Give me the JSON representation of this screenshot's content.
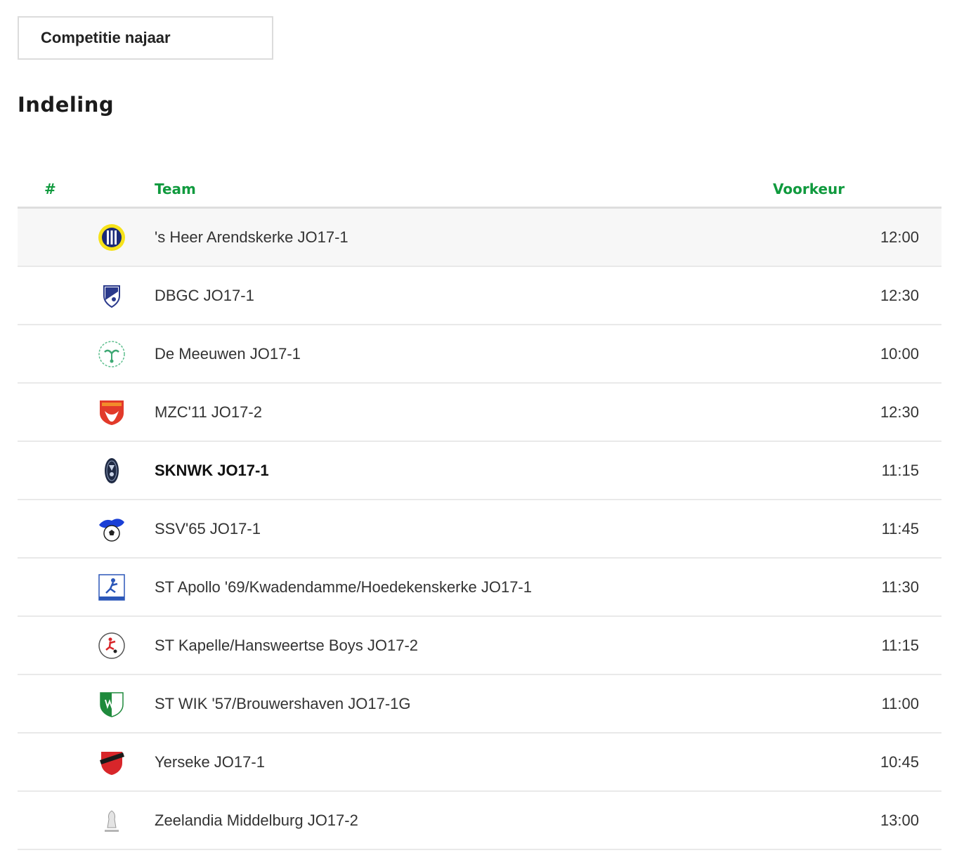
{
  "competition_select": {
    "value": "Competitie najaar"
  },
  "page_title": "Indeling",
  "table": {
    "headers": {
      "rank": "#",
      "team": "Team",
      "preference": "Voorkeur"
    },
    "rows": [
      {
        "team": "'s Heer Arendskerke JO17-1",
        "preference": "12:00",
        "logo_icon": "s-heer-arendskerke-logo-icon"
      },
      {
        "team": "DBGC JO17-1",
        "preference": "12:30",
        "logo_icon": "dbgc-logo-icon"
      },
      {
        "team": "De Meeuwen JO17-1",
        "preference": "10:00",
        "logo_icon": "de-meeuwen-logo-icon"
      },
      {
        "team": "MZC'11 JO17-2",
        "preference": "12:30",
        "logo_icon": "mzc11-logo-icon"
      },
      {
        "team": "SKNWK JO17-1",
        "preference": "11:15",
        "logo_icon": "sknwk-logo-icon",
        "own_team": true
      },
      {
        "team": "SSV'65 JO17-1",
        "preference": "11:45",
        "logo_icon": "ssv65-logo-icon"
      },
      {
        "team": "ST Apollo '69/Kwadendamme/Hoedekenskerke JO17-1",
        "preference": "11:30",
        "logo_icon": "apollo69-logo-icon"
      },
      {
        "team": "ST Kapelle/Hansweertse Boys JO17-2",
        "preference": "11:15",
        "logo_icon": "kapelle-logo-icon"
      },
      {
        "team": "ST WIK '57/Brouwershaven JO17-1G",
        "preference": "11:00",
        "logo_icon": "wik57-logo-icon"
      },
      {
        "team": "Yerseke JO17-1",
        "preference": "10:45",
        "logo_icon": "yerseke-logo-icon"
      },
      {
        "team": "Zeelandia Middelburg JO17-2",
        "preference": "13:00",
        "logo_icon": "zeelandia-logo-icon"
      }
    ]
  },
  "colors": {
    "header_accent": "#109a3e",
    "row_divider": "#e9e9e9",
    "highlight_row": "#f7f7f7"
  }
}
